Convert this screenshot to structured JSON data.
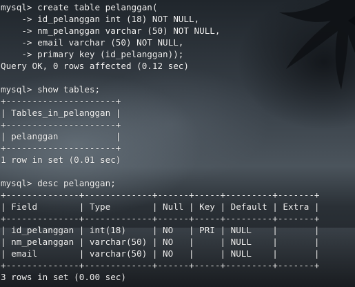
{
  "terminal": {
    "lines": [
      "mysql> create table pelanggan(",
      "    -> id_pelanggan int (18) NOT NULL,",
      "    -> nm_pelanggan varchar (50) NOT NULL,",
      "    -> email varchar (50) NOT NULL,",
      "    -> primary key (id_pelanggan));",
      "Query OK, 0 rows affected (0.12 sec)",
      "",
      "mysql> show tables;",
      "+---------------------+",
      "| Tables_in_pelanggan |",
      "+---------------------+",
      "| pelanggan           |",
      "+---------------------+",
      "1 row in set (0.01 sec)",
      "",
      "mysql> desc pelanggan;",
      "+--------------+-------------+------+-----+---------+-------+",
      "| Field        | Type        | Null | Key | Default | Extra |",
      "+--------------+-------------+------+-----+---------+-------+",
      "| id_pelanggan | int(18)     | NO   | PRI | NULL    |       |",
      "| nm_pelanggan | varchar(50) | NO   |     | NULL    |       |",
      "| email        | varchar(50) | NO   |     | NULL    |       |",
      "+--------------+-------------+------+-----+---------+-------+",
      "3 rows in set (0.00 sec)"
    ]
  },
  "colors": {
    "text": "#f2f2f2"
  }
}
